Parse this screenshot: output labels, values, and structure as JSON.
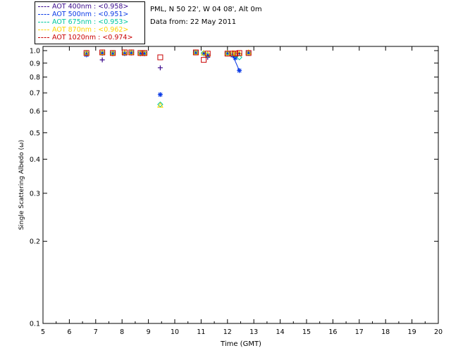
{
  "info": {
    "site": "PML, N 50 22', W 04 08', Alt 0m",
    "date_line": "Data from: 22 May 2011"
  },
  "legend": [
    {
      "label": "AOT  400nm : <0.958>",
      "color": "#3a0a8c"
    },
    {
      "label": "AOT  500nm : <0.951>",
      "color": "#0a3ae6"
    },
    {
      "label": "AOT  675nm : <0.953>",
      "color": "#00c8a0"
    },
    {
      "label": "AOT  870nm : <0.962>",
      "color": "#ffd400"
    },
    {
      "label": "AOT 1020nm : <0.974>",
      "color": "#c80000"
    }
  ],
  "chart_data": {
    "type": "scatter",
    "xlabel": "Time (GMT)",
    "ylabel": "Single Scattering Albedo (ω)",
    "xlim": [
      5,
      20
    ],
    "ylim": [
      0.1,
      1.0
    ],
    "yscale": "log",
    "x_ticks": [
      "5",
      "6",
      "7",
      "8",
      "9",
      "10",
      "11",
      "12",
      "13",
      "14",
      "15",
      "16",
      "17",
      "18",
      "19",
      "20"
    ],
    "y_ticks": [
      {
        "value": 1.0,
        "label": "1.0"
      },
      {
        "value": 0.9,
        "label": "0.9"
      },
      {
        "value": 0.8,
        "label": "0.8"
      },
      {
        "value": 0.7,
        "label": "0.7"
      },
      {
        "value": 0.6,
        "label": "0.6"
      },
      {
        "value": 0.5,
        "label": "0.5"
      },
      {
        "value": 0.4,
        "label": "0.4"
      },
      {
        "value": 0.3,
        "label": "0.3"
      },
      {
        "value": 0.2,
        "label": "0.2"
      },
      {
        "value": 0.1,
        "label": "0.1"
      }
    ],
    "series": [
      {
        "name": "AOT  400nm : <0.958>",
        "color": "#3a0a8c",
        "marker": "plus",
        "x": [
          6.65,
          7.25,
          7.65,
          8.1,
          8.35,
          8.7,
          8.85,
          9.45,
          10.8,
          11.1,
          11.25,
          12.0,
          12.2,
          12.3,
          12.45,
          12.8
        ],
        "y": [
          0.975,
          0.925,
          0.975,
          0.98,
          0.985,
          0.975,
          0.975,
          0.865,
          0.985,
          0.975,
          0.945,
          0.975,
          0.97,
          0.955,
          0.975,
          0.98
        ]
      },
      {
        "name": "AOT  500nm : <0.951>",
        "color": "#0a3ae6",
        "marker": "asterisk",
        "x": [
          6.65,
          7.25,
          7.65,
          8.1,
          8.35,
          8.7,
          8.85,
          9.45,
          10.8,
          11.1,
          11.25,
          12.0,
          12.2,
          12.3,
          12.45,
          12.8
        ],
        "y": [
          0.965,
          0.98,
          0.975,
          0.975,
          0.98,
          0.975,
          0.975,
          0.69,
          0.985,
          0.975,
          0.96,
          0.975,
          0.96,
          0.94,
          0.845,
          0.98
        ]
      },
      {
        "name": "AOT  675nm : <0.953>",
        "color": "#00c8a0",
        "marker": "diamond",
        "x": [
          6.65,
          7.25,
          7.65,
          8.1,
          8.35,
          8.7,
          8.85,
          9.45,
          10.8,
          11.1,
          11.25,
          12.0,
          12.2,
          12.3,
          12.45,
          12.8
        ],
        "y": [
          0.98,
          0.98,
          0.98,
          0.98,
          0.985,
          0.98,
          0.98,
          0.635,
          0.985,
          0.98,
          0.965,
          0.98,
          0.975,
          0.965,
          0.945,
          0.98
        ]
      },
      {
        "name": "AOT  870nm : <0.962>",
        "color": "#ffd400",
        "marker": "triangle",
        "x": [
          6.65,
          7.25,
          7.65,
          8.1,
          8.35,
          8.7,
          8.85,
          9.45,
          10.8,
          11.1,
          11.25,
          12.0,
          12.2,
          12.3,
          12.45,
          12.8
        ],
        "y": [
          0.98,
          0.985,
          0.98,
          0.985,
          0.985,
          0.98,
          0.98,
          0.63,
          0.985,
          0.98,
          0.97,
          0.98,
          0.98,
          0.975,
          0.975,
          0.985
        ]
      },
      {
        "name": "AOT 1020nm : <0.974>",
        "color": "#c80000",
        "marker": "square",
        "x": [
          6.65,
          7.25,
          7.65,
          8.1,
          8.35,
          8.7,
          8.85,
          9.45,
          10.8,
          11.1,
          11.25,
          12.0,
          12.2,
          12.3,
          12.45,
          12.8
        ],
        "y": [
          0.98,
          0.985,
          0.98,
          0.985,
          0.985,
          0.98,
          0.98,
          0.945,
          0.985,
          0.925,
          0.975,
          0.975,
          0.975,
          0.975,
          0.98,
          0.98
        ]
      }
    ]
  }
}
